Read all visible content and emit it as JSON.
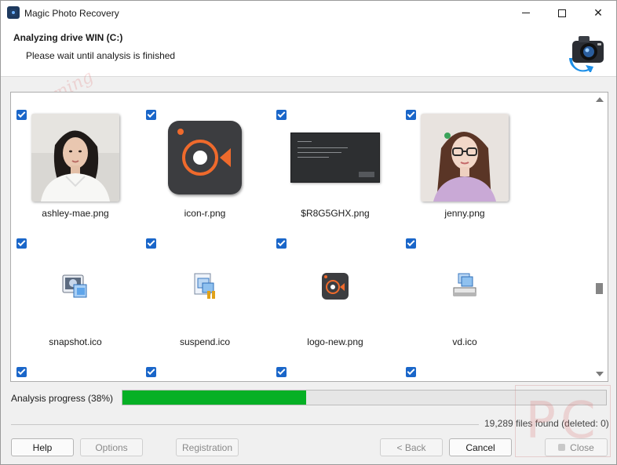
{
  "window": {
    "title": "Magic Photo Recovery"
  },
  "header": {
    "title": "Analyzing drive WIN (C:)",
    "subtitle": "Please wait until analysis is finished"
  },
  "gallery": {
    "items": [
      {
        "name": "ashley-mae.png",
        "checked": true,
        "kind": "photo-woman-white-shirt"
      },
      {
        "name": "icon-r.png",
        "checked": true,
        "kind": "recorder-app-icon"
      },
      {
        "name": "$R8G5GHX.png",
        "checked": true,
        "kind": "dark-dialog-screenshot"
      },
      {
        "name": "jenny.png",
        "checked": true,
        "kind": "photo-woman-glasses"
      },
      {
        "name": "snapshot.ico",
        "checked": true,
        "kind": "snapshot-icon"
      },
      {
        "name": "suspend.ico",
        "checked": true,
        "kind": "suspend-icon"
      },
      {
        "name": "logo-new.png",
        "checked": true,
        "kind": "recorder-app-icon-small"
      },
      {
        "name": "vd.ico",
        "checked": true,
        "kind": "drive-icon"
      },
      {
        "name": "",
        "checked": true
      },
      {
        "name": "",
        "checked": true
      },
      {
        "name": "",
        "checked": true
      },
      {
        "name": "",
        "checked": true
      }
    ]
  },
  "progress": {
    "label": "Analysis progress (38%)",
    "percent": 38,
    "color": "#06b025"
  },
  "status": {
    "files_found": "19,289 files found (deleted: 0)"
  },
  "buttons": {
    "help": "Help",
    "options": "Options",
    "registration": "Registration",
    "back": "< Back",
    "cancel": "Cancel",
    "close": "Close"
  },
  "icons": {
    "app": "camera-recovery-icon",
    "header_logo": "camera-recovery-logo"
  }
}
